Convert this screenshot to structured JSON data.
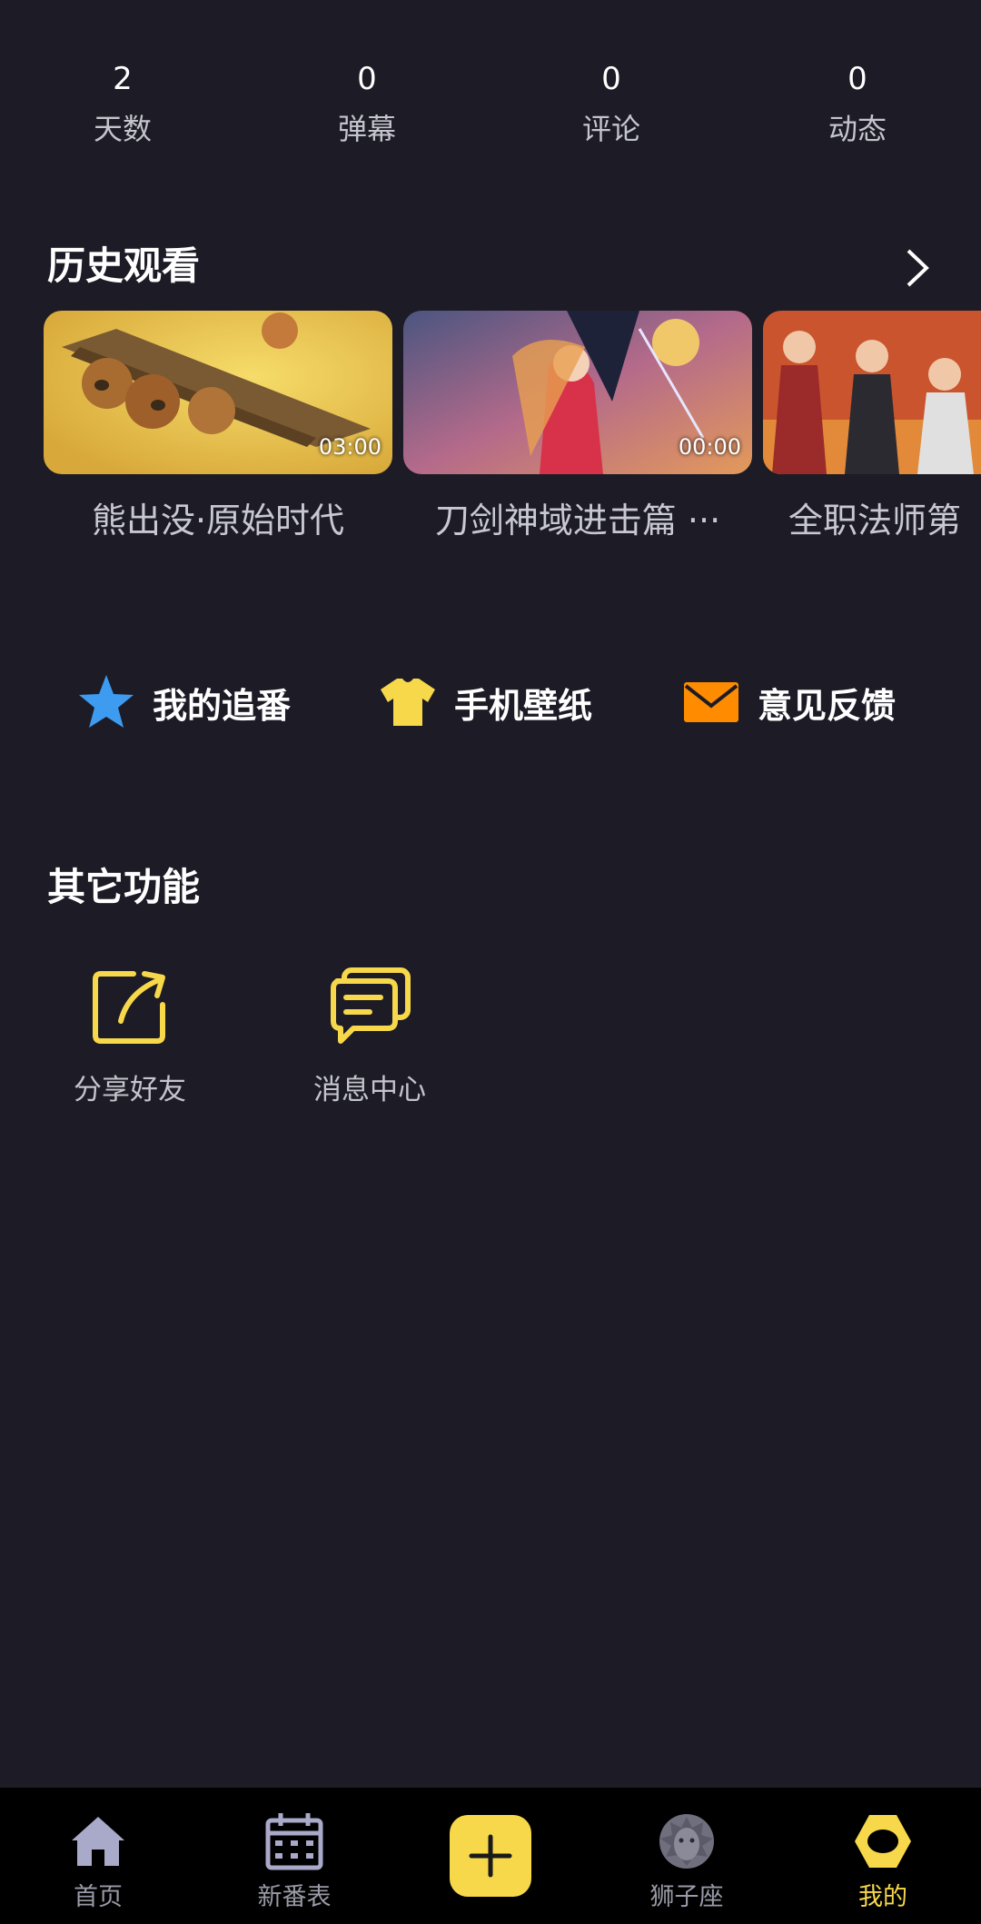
{
  "stats": [
    {
      "value": "2",
      "label": "天数"
    },
    {
      "value": "0",
      "label": "弹幕"
    },
    {
      "value": "0",
      "label": "评论"
    },
    {
      "value": "0",
      "label": "动态"
    }
  ],
  "history": {
    "title": "历史观看",
    "items": [
      {
        "title": "熊出没·原始时代",
        "duration": "03:00"
      },
      {
        "title": "刀剑神域进击篇 ···",
        "duration": "00:00"
      },
      {
        "title": "全职法师第",
        "duration": ""
      }
    ]
  },
  "quick_actions": [
    {
      "label": "我的追番",
      "icon": "star-icon",
      "color": "#3d9bf0"
    },
    {
      "label": "手机壁纸",
      "icon": "tshirt-icon",
      "color": "#f7d84a"
    },
    {
      "label": "意见反馈",
      "icon": "mail-icon",
      "color": "#ff8c00"
    }
  ],
  "other": {
    "title": "其它功能",
    "items": [
      {
        "label": "分享好友",
        "icon": "share-icon"
      },
      {
        "label": "消息中心",
        "icon": "message-icon"
      }
    ]
  },
  "tabbar": {
    "items": [
      {
        "label": "首页",
        "icon": "home-icon"
      },
      {
        "label": "新番表",
        "icon": "calendar-icon"
      },
      {
        "label": "",
        "icon": "plus-icon"
      },
      {
        "label": "狮子座",
        "icon": "lion-icon"
      },
      {
        "label": "我的",
        "icon": "profile-hexagon-icon",
        "active": true
      }
    ]
  },
  "colors": {
    "accent": "#f7d84a",
    "background": "#1c1b26",
    "tabbar": "#000000"
  }
}
